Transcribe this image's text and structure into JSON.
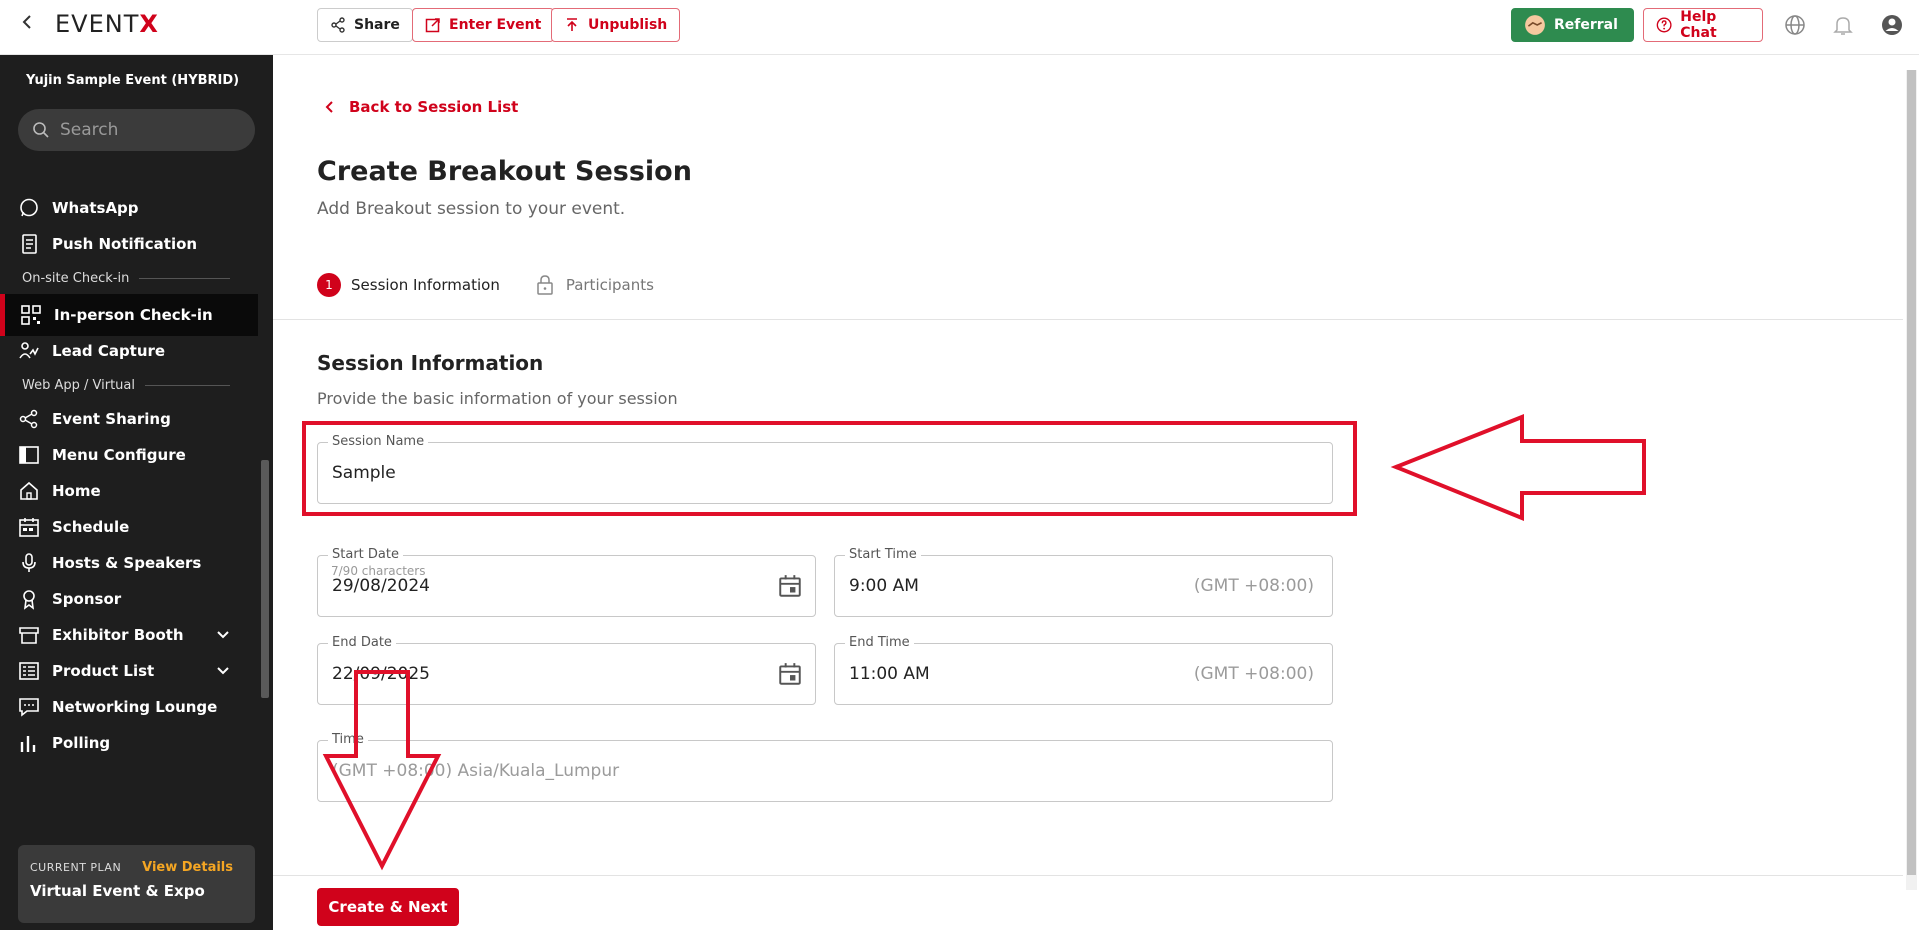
{
  "topbar": {
    "logo": "EVENT",
    "logo_x": "X",
    "share_label": "Share",
    "enter_label": "Enter Event",
    "unpublish_label": "Unpublish",
    "referral_label": "Referral",
    "help_label": "Help Chat"
  },
  "sidebar": {
    "event_name": "Yujin Sample Event (HYBRID)",
    "search_placeholder": "Search",
    "items": [
      {
        "label": "WhatsApp",
        "icon": "whatsapp-icon"
      },
      {
        "label": "Push Notification",
        "icon": "push-notification-icon"
      },
      {
        "label": "In-person Check-in",
        "icon": "qr-icon",
        "active": true
      },
      {
        "label": "Lead Capture",
        "icon": "lead-capture-icon"
      },
      {
        "label": "Event Sharing",
        "icon": "share-icon"
      },
      {
        "label": "Menu Configure",
        "icon": "menu-configure-icon"
      },
      {
        "label": "Home",
        "icon": "home-icon"
      },
      {
        "label": "Schedule",
        "icon": "schedule-icon"
      },
      {
        "label": "Hosts & Speakers",
        "icon": "microphone-icon"
      },
      {
        "label": "Sponsor",
        "icon": "sponsor-icon"
      },
      {
        "label": "Exhibitor Booth",
        "icon": "booth-icon"
      },
      {
        "label": "Product List",
        "icon": "product-list-icon"
      },
      {
        "label": "Networking Lounge",
        "icon": "chat-icon"
      },
      {
        "label": "Polling",
        "icon": "polling-icon"
      }
    ],
    "sections": [
      "On-site Check-in",
      "Web App / Virtual"
    ],
    "plan": {
      "label": "CURRENT PLAN",
      "link": "View Details",
      "name": "Virtual Event & Expo"
    }
  },
  "main": {
    "back_label": "Back to Session List",
    "title": "Create Breakout Session",
    "subtitle": "Add Breakout session to your event.",
    "steps": [
      {
        "num": "1",
        "label": "Session Information"
      },
      {
        "label": "Participants"
      }
    ],
    "section_title": "Session Information",
    "section_sub": "Provide the basic information of your session",
    "form": {
      "session_name_label": "Session Name",
      "session_name_value": "Sample",
      "counter": "7/90 characters",
      "start_date_label": "Start Date",
      "start_date_value": "29/08/2024",
      "start_time_label": "Start Time",
      "start_time_value": "9:00 AM",
      "end_date_label": "End Date",
      "end_date_value": "22/09/2025",
      "end_time_label": "End Time",
      "end_time_value": "11:00 AM",
      "gmt": "(GMT +08:00)",
      "timezone_label": "Time",
      "timezone_value": "(GMT +08:00) Asia/Kuala_Lumpur"
    },
    "submit_label": "Create & Next"
  },
  "colors": {
    "brand": "#d0021b",
    "sidebar_bg": "#1e1e1e",
    "referral": "#2e8b4f",
    "annotation": "#e0102a"
  }
}
